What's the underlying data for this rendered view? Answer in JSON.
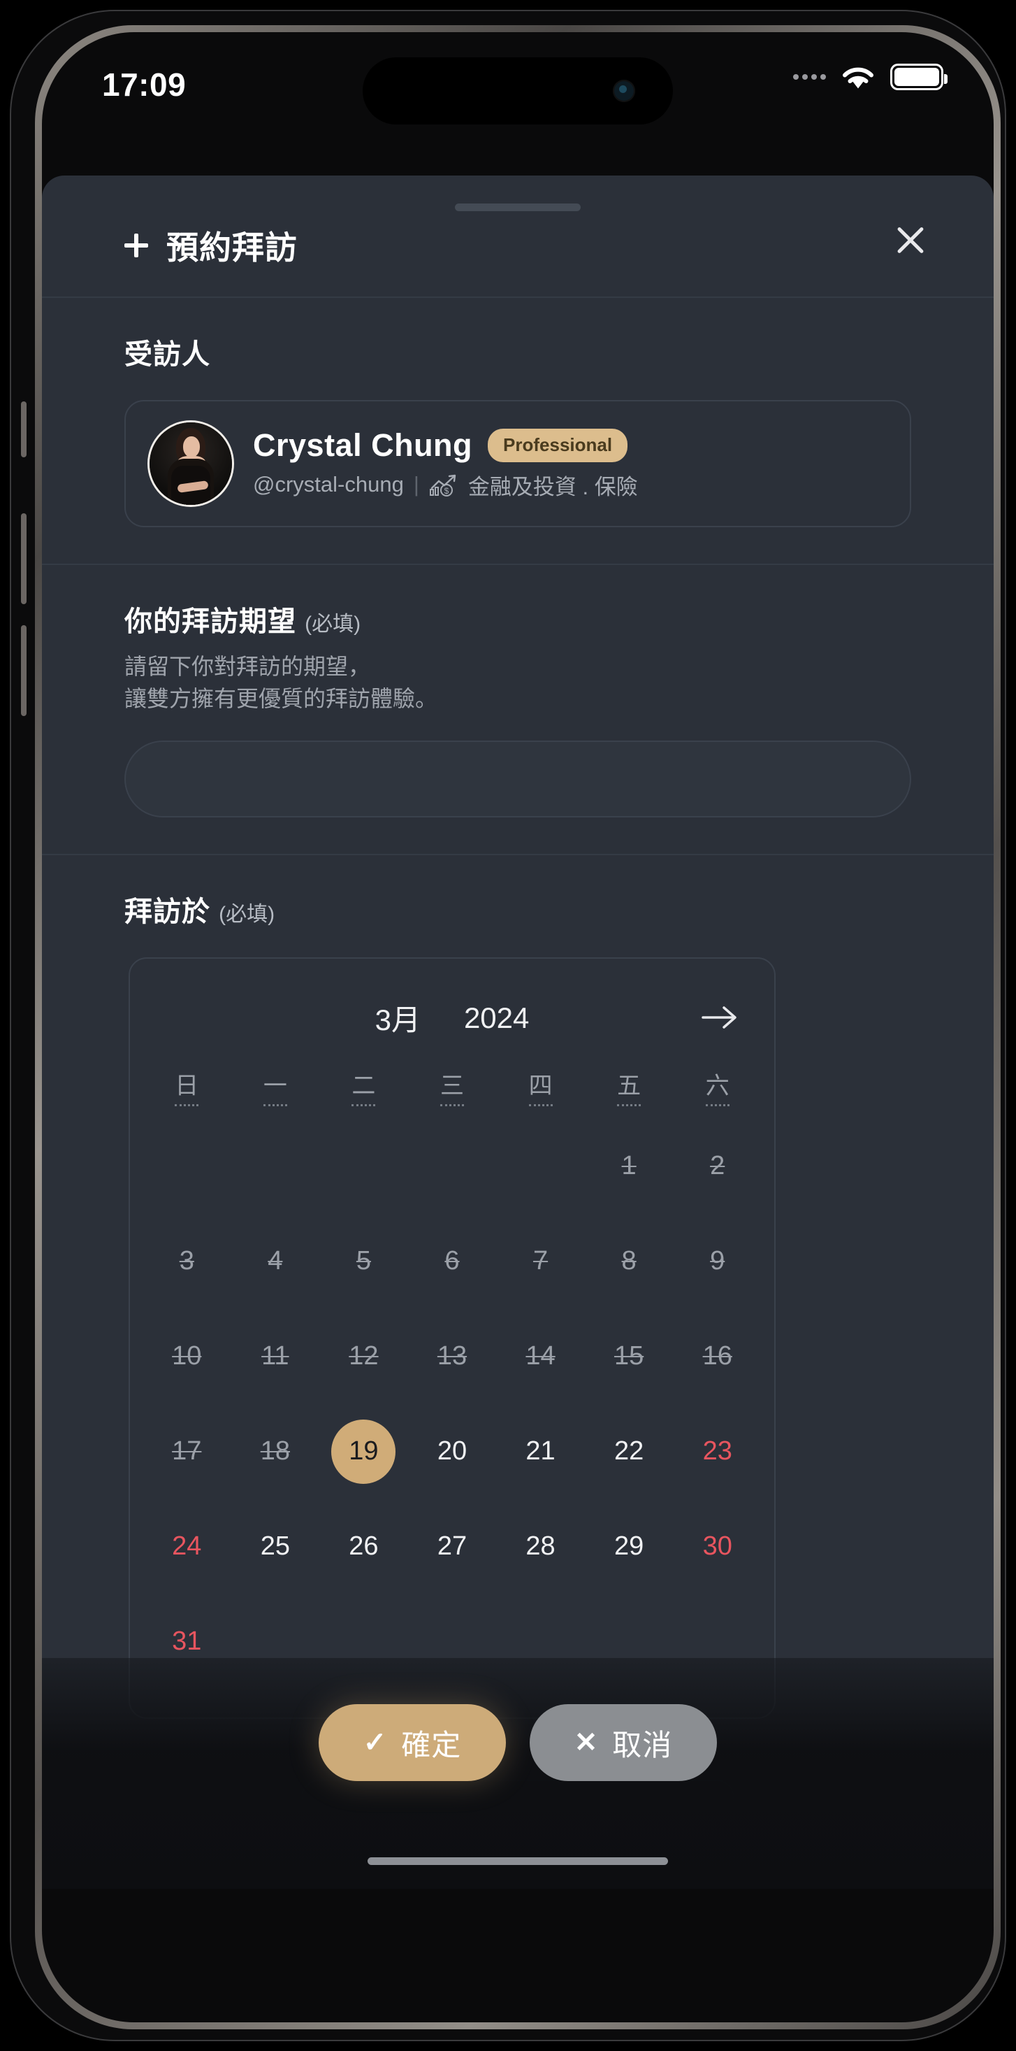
{
  "status_bar": {
    "time": "17:09",
    "signal_icon": "signal-dots-icon",
    "wifi_icon": "wifi-icon",
    "battery_icon": "battery-full-icon"
  },
  "sheet": {
    "title": "預約拜訪",
    "title_icon": "plus-icon",
    "close_icon": "close-icon"
  },
  "visitee_section": {
    "label": "受訪人",
    "card": {
      "avatar": "user-avatar",
      "name": "Crystal Chung",
      "badge": "Professional",
      "handle": "@crystal-chung",
      "divider": "|",
      "category_icon": "finance-chart-icon",
      "category": "金融及投資 . 保險"
    }
  },
  "expectation_section": {
    "label": "你的拜訪期望",
    "required": "(必填)",
    "description_line1": "請留下你對拜訪的期望，",
    "description_line2": "讓雙方擁有更優質的拜訪體驗。",
    "input_value": "",
    "input_placeholder": ""
  },
  "date_section": {
    "label": "拜訪於",
    "required": "(必填)",
    "calendar": {
      "month": "3月",
      "year": "2024",
      "next_icon": "arrow-right-icon",
      "weekdays": [
        "日",
        "一",
        "二",
        "三",
        "四",
        "五",
        "六"
      ],
      "selected_day": 19,
      "leading_blanks": 5,
      "days": [
        {
          "n": 1,
          "state": "disabled"
        },
        {
          "n": 2,
          "state": "disabled"
        },
        {
          "n": 3,
          "state": "disabled"
        },
        {
          "n": 4,
          "state": "disabled"
        },
        {
          "n": 5,
          "state": "disabled"
        },
        {
          "n": 6,
          "state": "disabled"
        },
        {
          "n": 7,
          "state": "disabled"
        },
        {
          "n": 8,
          "state": "disabled"
        },
        {
          "n": 9,
          "state": "disabled"
        },
        {
          "n": 10,
          "state": "disabled"
        },
        {
          "n": 11,
          "state": "disabled"
        },
        {
          "n": 12,
          "state": "disabled"
        },
        {
          "n": 13,
          "state": "disabled"
        },
        {
          "n": 14,
          "state": "disabled"
        },
        {
          "n": 15,
          "state": "disabled"
        },
        {
          "n": 16,
          "state": "disabled"
        },
        {
          "n": 17,
          "state": "disabled"
        },
        {
          "n": 18,
          "state": "disabled"
        },
        {
          "n": 19,
          "state": "selected"
        },
        {
          "n": 20,
          "state": "normal"
        },
        {
          "n": 21,
          "state": "normal"
        },
        {
          "n": 22,
          "state": "normal"
        },
        {
          "n": 23,
          "state": "weekend"
        },
        {
          "n": 24,
          "state": "weekend"
        },
        {
          "n": 25,
          "state": "normal"
        },
        {
          "n": 26,
          "state": "normal"
        },
        {
          "n": 27,
          "state": "normal"
        },
        {
          "n": 28,
          "state": "normal"
        },
        {
          "n": 29,
          "state": "normal"
        },
        {
          "n": 30,
          "state": "weekend"
        },
        {
          "n": 31,
          "state": "weekend"
        }
      ]
    }
  },
  "footer": {
    "confirm_label": "確定",
    "confirm_icon": "check-icon",
    "cancel_label": "取消",
    "cancel_icon": "cross-icon"
  },
  "colors": {
    "accent_gold": "#cdab79",
    "badge_bg": "#dcbd8d",
    "badge_text": "#4a3b1e",
    "weekend_red": "#e8555f",
    "sheet_bg": "#2b3039",
    "cancel_grey": "#8b8e92"
  }
}
